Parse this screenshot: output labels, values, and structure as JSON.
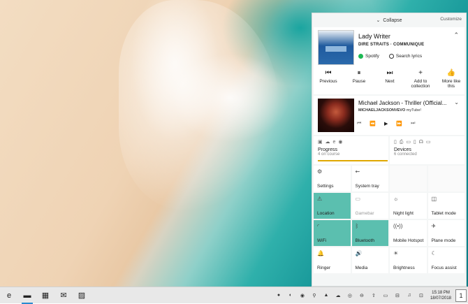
{
  "panel": {
    "collapse": "Collapse",
    "customize": "Customize"
  },
  "music": {
    "title": "Lady Writer",
    "subtitle": "DIRE STRAITS · COMMUNIQUE",
    "source": "Spotify",
    "lyrics": "Search lyrics",
    "controls": [
      {
        "icon": "⏮",
        "label": "Previous"
      },
      {
        "icon": "⏸",
        "label": "Pause"
      },
      {
        "icon": "⏭",
        "label": "Next"
      },
      {
        "icon": "+",
        "label": "Add to collection"
      },
      {
        "icon": "👍",
        "label": "More like this"
      }
    ]
  },
  "video": {
    "title": "Michael Jackson - Thriller (Official...",
    "channel": "MICHAELJACKSONVEVO",
    "app": "myTube!",
    "controls": [
      "⏮",
      "⏪",
      "▶",
      "⏩",
      "⏭"
    ]
  },
  "progress": {
    "label": "Progress",
    "sub": "4 on course",
    "icons": "▣ ☁ e ◉"
  },
  "devices": {
    "label": "Devices",
    "sub": "6 connected",
    "icons": "▯ ⎙ ▭ ▯ ☊ ▭"
  },
  "tiles": [
    {
      "label": "Settings",
      "icon": "⚙",
      "state": "normal"
    },
    {
      "label": "System tray",
      "icon": "⇜",
      "state": "normal"
    },
    {
      "label": "",
      "icon": "",
      "state": "empty"
    },
    {
      "label": "",
      "icon": "",
      "state": "empty"
    },
    {
      "label": "Location",
      "icon": "⚠",
      "state": "on"
    },
    {
      "label": "Gamebar",
      "icon": "▭",
      "state": "dim"
    },
    {
      "label": "Night light",
      "icon": "☼",
      "state": "normal"
    },
    {
      "label": "Tablet mode",
      "icon": "◫",
      "state": "normal"
    },
    {
      "label": "WiFi",
      "icon": "◜",
      "state": "on"
    },
    {
      "label": "Bluetooth",
      "icon": "ᛒ",
      "state": "on"
    },
    {
      "label": "Mobile Hotspot",
      "icon": "((•))",
      "state": "normal"
    },
    {
      "label": "Plane mode",
      "icon": "✈",
      "state": "normal"
    },
    {
      "label": "Ringer",
      "icon": "🔔",
      "state": "normal"
    },
    {
      "label": "Media",
      "icon": "🔊",
      "state": "normal"
    },
    {
      "label": "Brightness",
      "icon": "☀",
      "state": "normal"
    },
    {
      "label": "Focus assist",
      "icon": "☾",
      "state": "normal"
    }
  ],
  "taskbar": {
    "apps": [
      {
        "icon": "e",
        "name": "edge-icon"
      },
      {
        "icon": "▬",
        "name": "file-explorer-icon"
      },
      {
        "icon": "▦",
        "name": "store-icon"
      },
      {
        "icon": "✉",
        "name": "mail-icon"
      },
      {
        "icon": "▨",
        "name": "photos-icon"
      }
    ],
    "tray": [
      "●",
      "◐",
      "◉",
      "⚲",
      "▲",
      "☁",
      "◎",
      "⊖",
      "⇧",
      "▭",
      "⊟",
      "♫",
      "⊡"
    ],
    "time": "15:18 PM",
    "date": "18/07/2018",
    "notification_count": "1"
  }
}
